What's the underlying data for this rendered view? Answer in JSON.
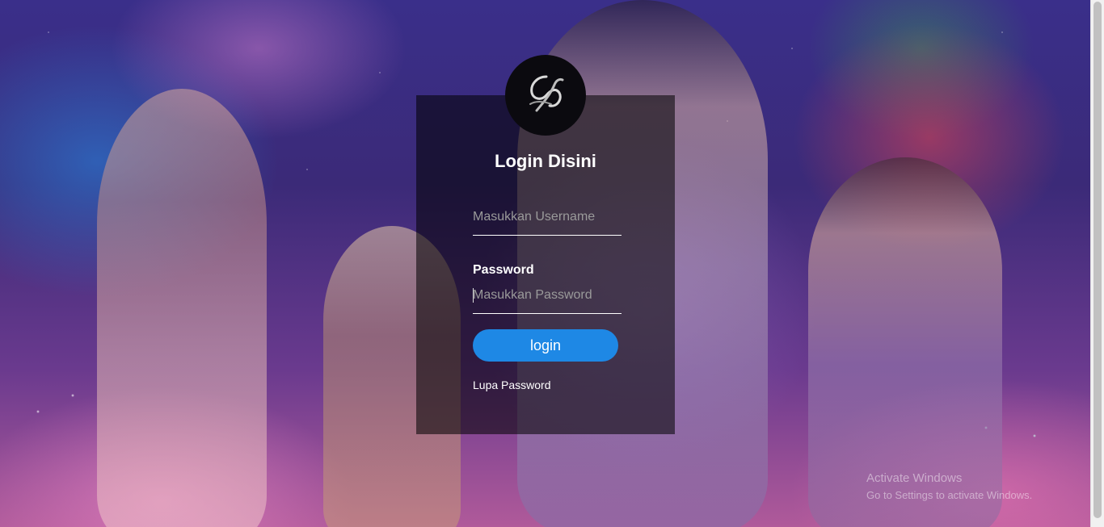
{
  "login": {
    "title": "Login Disini",
    "username_placeholder": "Masukkan Username",
    "password_label": "Password",
    "password_placeholder": "Masukkan Password",
    "button_label": "login",
    "forgot_link": "Lupa Password"
  },
  "watermark": {
    "line1": "Activate Windows",
    "line2": "Go to Settings to activate Windows."
  },
  "colors": {
    "button": "#1e88e5",
    "panel": "rgba(0,0,0,0.55)"
  },
  "icons": {
    "logo": "ae-logo-icon"
  }
}
